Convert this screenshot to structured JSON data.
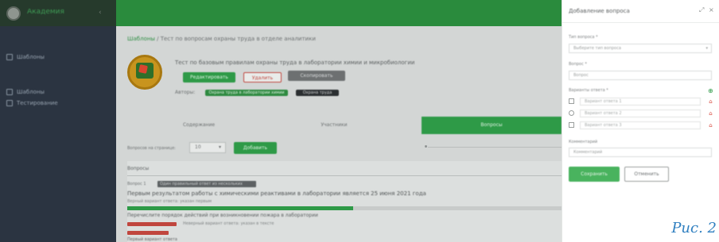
{
  "sidebar": {
    "brand": "Академия",
    "caption_1": "",
    "caption_2": "",
    "items": [
      {
        "label": "Шаблоны"
      },
      {
        "label": "Шаблоны"
      },
      {
        "label": "Тестирование"
      }
    ]
  },
  "main": {
    "breadcrumb_root": "Шаблоны",
    "breadcrumb_rest": " / Тест по вопросам охраны труда в отделе аналитики",
    "course_title": "Тест по базовым правилам охраны труда в лаборатории химии и микробиологии",
    "buttons": {
      "primary": "Редактировать",
      "danger": "Удалить",
      "secondary": "Скопировать"
    },
    "authors_label": "Авторы:",
    "badges": [
      "Охрана труда в лаборатории химии",
      "Охрана труда"
    ],
    "tabs": [
      "Содержание",
      "Участники",
      "Вопросы"
    ],
    "filter_label": "Вопросов на странице:",
    "filter_value": "10",
    "filter_button": "Добавить",
    "questions_heading": "Вопросы",
    "q1_label": "Вопрос 1",
    "q1_tag": "Один правильный ответ из нескольких",
    "q1_text": "Первым результатом работы с химическими реактивами в лаборатории является 25 июня 2021 года",
    "q1_sub": "Верный вариант ответа: указан первым",
    "progress_value": 0.52,
    "q2_text": "Перечислите порядок действий при возникновении пожара в лаборатории",
    "q2_sub": "Неверный вариант ответа: указан в тексте",
    "q3_text": "Первый вариант ответа"
  },
  "panel": {
    "title": "Добавление вопроса",
    "expand_icon": "expand-icon",
    "close_icon": "close-icon",
    "type_label": "Тип вопроса *",
    "type_value": "Выберите тип вопроса",
    "text_label": "Вопрос *",
    "text_placeholder": "Вопрос",
    "answers_label": "Варианты ответа *",
    "answers": [
      {
        "placeholder": "Вариант ответа 1"
      },
      {
        "placeholder": "Вариант ответа 2"
      },
      {
        "placeholder": "Вариант ответа 3"
      }
    ],
    "comment_label": "Комментарий",
    "comment_placeholder": "Комментарий",
    "save_label": "Сохранить",
    "cancel_label": "Отменить"
  },
  "caption": "Рис. 2",
  "colors": {
    "accent": "#2e9a47",
    "sidebar": "#2b3441",
    "danger": "#d84c42",
    "caption": "#2f7fc0"
  }
}
